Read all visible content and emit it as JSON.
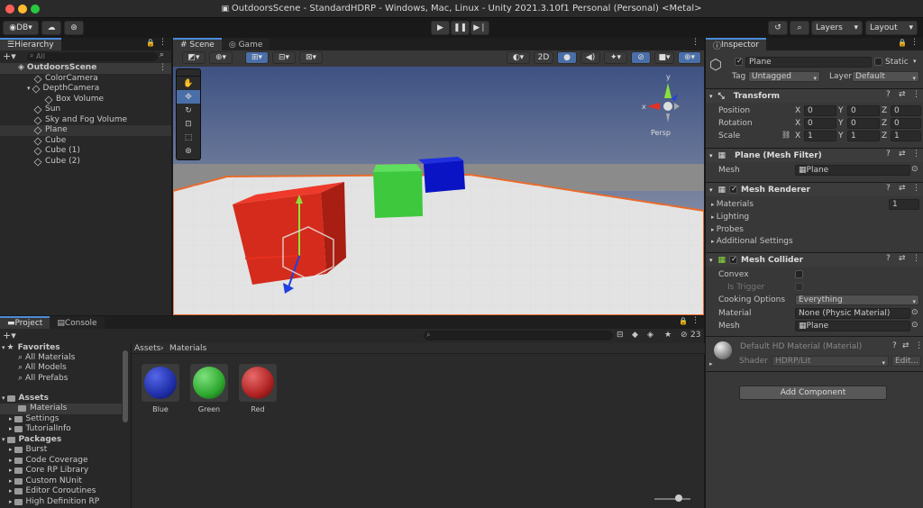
{
  "window": {
    "title": "OutdoorsScene - StandardHDRP - Windows, Mac, Linux - Unity 2021.3.10f1 Personal (Personal) <Metal>"
  },
  "toolbar": {
    "account": "DB",
    "layers": "Layers",
    "layout": "Layout"
  },
  "hierarchy": {
    "tab": "Hierarchy",
    "search_placeholder": "All",
    "scene": "OutdoorsScene",
    "items": [
      "ColorCamera",
      "DepthCamera",
      "Box Volume",
      "Sun",
      "Sky and Fog Volume",
      "Plane",
      "Cube",
      "Cube (1)",
      "Cube (2)"
    ]
  },
  "scene_view": {
    "scene_tab": "Scene",
    "game_tab": "Game",
    "mode_2d": "2D",
    "persp": "Persp",
    "gizmo": {
      "x": "x",
      "y": "y"
    }
  },
  "project": {
    "tab": "Project",
    "console_tab": "Console",
    "count": "23",
    "breadcrumb": [
      "Assets",
      "Materials"
    ],
    "favorites": {
      "label": "Favorites",
      "items": [
        "All Materials",
        "All Models",
        "All Prefabs"
      ]
    },
    "assets": {
      "label": "Assets",
      "items": [
        "Materials",
        "Settings",
        "TutorialInfo"
      ]
    },
    "packages": {
      "label": "Packages",
      "items": [
        "Burst",
        "Code Coverage",
        "Core RP Library",
        "Custom NUnit",
        "Editor Coroutines",
        "High Definition RP"
      ]
    },
    "materials": [
      {
        "name": "Blue",
        "color": "#1f2fa8"
      },
      {
        "name": "Green",
        "color": "#2ea82e"
      },
      {
        "name": "Red",
        "color": "#b02222"
      }
    ]
  },
  "inspector": {
    "tab": "Inspector",
    "object_name": "Plane",
    "static_label": "Static",
    "tag_label": "Tag",
    "tag_value": "Untagged",
    "layer_label": "Layer",
    "layer_value": "Default",
    "transform": {
      "title": "Transform",
      "rows": [
        {
          "label": "Position",
          "x": "0",
          "y": "0",
          "z": "0"
        },
        {
          "label": "Rotation",
          "x": "0",
          "y": "0",
          "z": "0"
        },
        {
          "label": "Scale",
          "x": "1",
          "y": "1",
          "z": "1"
        }
      ]
    },
    "mesh_filter": {
      "title": "Plane (Mesh Filter)",
      "mesh_label": "Mesh",
      "mesh_value": "Plane"
    },
    "mesh_renderer": {
      "title": "Mesh Renderer",
      "materials_label": "Materials",
      "materials_count": "1",
      "lighting": "Lighting",
      "probes": "Probes",
      "additional": "Additional Settings"
    },
    "mesh_collider": {
      "title": "Mesh Collider",
      "convex": "Convex",
      "is_trigger": "Is Trigger",
      "cooking_label": "Cooking Options",
      "cooking_value": "Everything",
      "material_label": "Material",
      "material_value": "None (Physic Material)",
      "mesh_label": "Mesh",
      "mesh_value": "Plane"
    },
    "material": {
      "title": "Default HD Material (Material)",
      "shader_label": "Shader",
      "shader_value": "HDRP/Lit",
      "edit": "Edit..."
    },
    "add_component": "Add Component"
  },
  "axis_labels": {
    "x": "X",
    "y": "Y",
    "z": "Z"
  }
}
